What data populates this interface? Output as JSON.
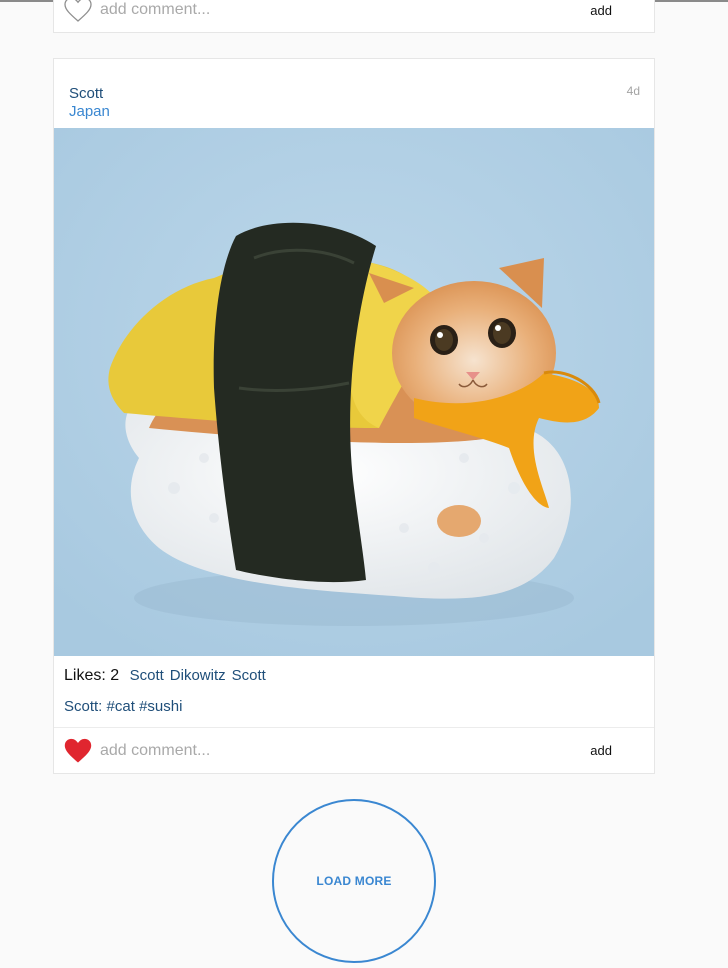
{
  "previous_post": {
    "liked": false,
    "comment_placeholder": "add comment...",
    "add_label": "add"
  },
  "post": {
    "author": "Scott",
    "location": "Japan",
    "time_ago": "4d",
    "photo_description": "cat-dressed-as-tamago-sushi",
    "likes_label": "Likes:",
    "likes_count": "2",
    "likers": [
      "Scott",
      "Dikowitz",
      "Scott"
    ],
    "caption": {
      "author": "Scott:",
      "hashtags": [
        "#cat",
        "#sushi"
      ]
    },
    "liked": true,
    "comment_placeholder": "add comment...",
    "add_label": "add"
  },
  "load_more_label": "LOAD MORE",
  "colors": {
    "page_bg": "#fafafa",
    "link_dark": "#1f4e79",
    "link_blue": "#3a87d1",
    "heart_liked": "#e0262f",
    "photo_bg": "#b3d1e6"
  }
}
